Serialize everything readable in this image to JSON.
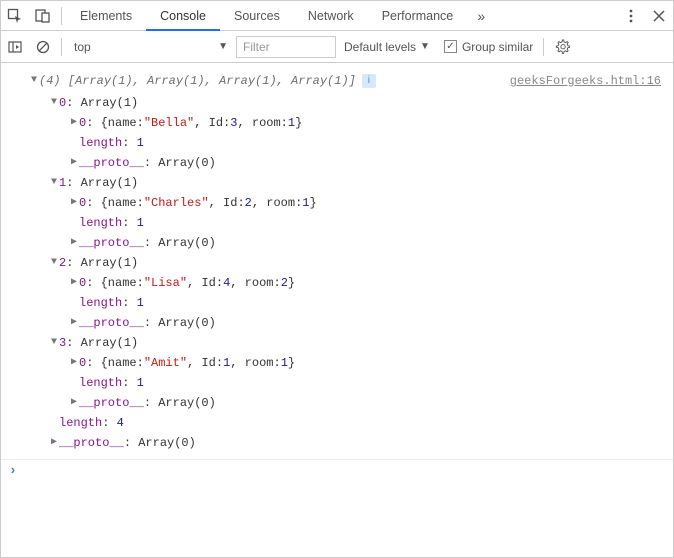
{
  "tabs": {
    "elements": "Elements",
    "console": "Console",
    "sources": "Sources",
    "network": "Network",
    "performance": "Performance"
  },
  "toolbar": {
    "context": "top",
    "filter_placeholder": "Filter",
    "levels": "Default levels",
    "group": "Group similar"
  },
  "source_link": "geeksForgeeks.html:16",
  "summary": {
    "count": "(4)",
    "text": "[Array(1), Array(1), Array(1), Array(1)]"
  },
  "entries": [
    {
      "idx": "0",
      "arr": "Array(1)",
      "obj": {
        "pre": "{name: ",
        "name": "\"Bella\"",
        "mid1": ", Id: ",
        "id": "3",
        "mid2": ", room: ",
        "room": "1",
        "post": "}"
      },
      "length_key": "length",
      "length_val": "1",
      "proto_key": "__proto__",
      "proto_val": "Array(0)"
    },
    {
      "idx": "1",
      "arr": "Array(1)",
      "obj": {
        "pre": "{name: ",
        "name": "\"Charles\"",
        "mid1": ", Id: ",
        "id": "2",
        "mid2": ", room: ",
        "room": "1",
        "post": "}"
      },
      "length_key": "length",
      "length_val": "1",
      "proto_key": "__proto__",
      "proto_val": "Array(0)"
    },
    {
      "idx": "2",
      "arr": "Array(1)",
      "obj": {
        "pre": "{name: ",
        "name": "\"Lisa\"",
        "mid1": ", Id: ",
        "id": "4",
        "mid2": ", room: ",
        "room": "2",
        "post": "}"
      },
      "length_key": "length",
      "length_val": "1",
      "proto_key": "__proto__",
      "proto_val": "Array(0)"
    },
    {
      "idx": "3",
      "arr": "Array(1)",
      "obj": {
        "pre": "{name: ",
        "name": "\"Amit\"",
        "mid1": ", Id: ",
        "id": "1",
        "mid2": ", room: ",
        "room": "1",
        "post": "}"
      },
      "length_key": "length",
      "length_val": "1",
      "proto_key": "__proto__",
      "proto_val": "Array(0)"
    }
  ],
  "outer": {
    "length_key": "length",
    "length_val": "4",
    "proto_key": "__proto__",
    "proto_val": "Array(0)"
  }
}
